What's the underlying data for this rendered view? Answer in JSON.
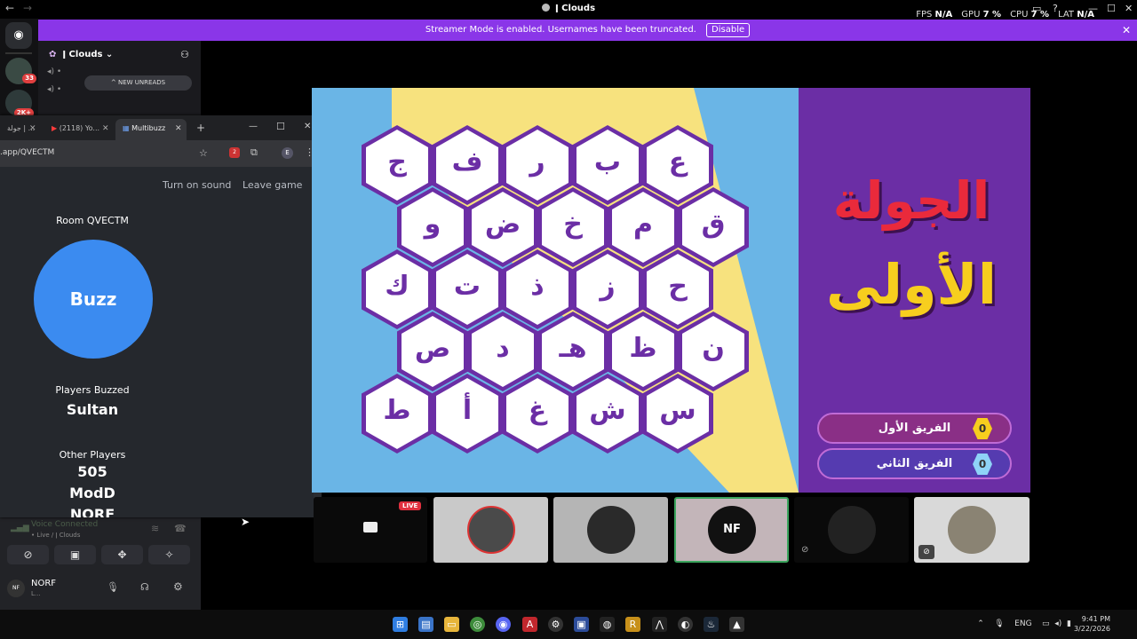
{
  "topbar": {
    "title": "Clouds",
    "title_prefix": "ǀ",
    "fps_label": "FPS",
    "fps_value": "N/A",
    "gpu_label": "GPU",
    "gpu_value": "7 %",
    "cpu_label": "CPU",
    "cpu_value": "7 %",
    "lat_label": "LAT",
    "lat_value": "N/A"
  },
  "banner": {
    "text": "Streamer Mode is enabled. Usernames have been truncated.",
    "button": "Disable"
  },
  "rail": {
    "badges": [
      "33",
      "2K+"
    ]
  },
  "channel": {
    "server_name": "ǀ Clouds",
    "new_unreads": "NEW UNREADS"
  },
  "voice": {
    "status": "Voice Connected",
    "sub": "• Live / ǀ Clouds",
    "user_name": "NORF",
    "user_sub": "L...",
    "avatar_text": "NF"
  },
  "browser": {
    "tabs": [
      {
        "label": "جولة | ..."
      },
      {
        "label": "(2118) Yo..."
      },
      {
        "label": "Multibuzz"
      }
    ],
    "url": ".app/QVECTM",
    "ext_badge": "2",
    "profile": "E"
  },
  "multibuzz": {
    "turn_on_sound": "Turn on sound",
    "leave_game": "Leave game",
    "room": "Room QVECTM",
    "buzz": "Buzz",
    "players_buzzed_label": "Players Buzzed",
    "players_buzzed": [
      "Sultan"
    ],
    "other_players_label": "Other Players",
    "other_players": [
      "505",
      "ModD",
      "NORF"
    ]
  },
  "game": {
    "title_line1": "الجولة",
    "title_line2": "الأولى",
    "team1_name": "الفريق الأول",
    "team1_score": "0",
    "team2_name": "الفريق الثاني",
    "team2_score": "0",
    "rows": [
      [
        "ج",
        "ف",
        "ر",
        "ب",
        "ع"
      ],
      [
        "و",
        "ض",
        "خ",
        "م",
        "ق"
      ],
      [
        "ك",
        "ت",
        "ذ",
        "ز",
        "ح"
      ],
      [
        "ص",
        "د",
        "هـ",
        "ظ",
        "ن"
      ],
      [
        "ط",
        "أ",
        "غ",
        "ش",
        "س"
      ]
    ],
    "colors": {
      "purple": "#6b2ea5",
      "sky": "#6ab5e6",
      "yellow": "#f7e27e",
      "red": "#ea2a3b",
      "gold": "#f7ce1e",
      "score_team1": "#f7ce1e",
      "score_team2": "#8fd3f7"
    }
  },
  "stream_tiles": {
    "live_badge": "LIVE",
    "center_avatar": "NF"
  },
  "taskbar": {
    "lang": "ENG",
    "time": "9:41 PM",
    "date": "3/22/2026"
  }
}
